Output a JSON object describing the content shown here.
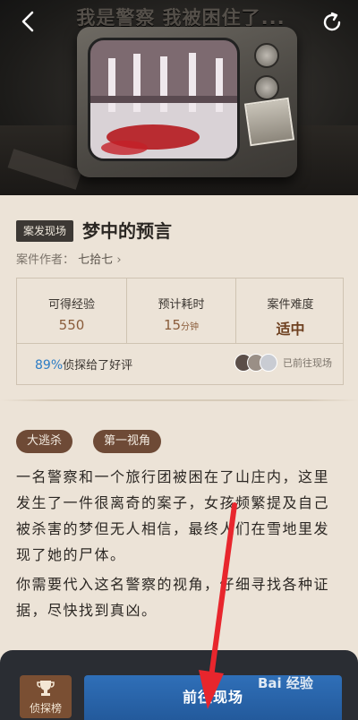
{
  "hero": {
    "banner_text": "我是警察 我被困住了..."
  },
  "case": {
    "tag": "案发现场",
    "title": "梦中的预言",
    "author_label": "案件作者：",
    "author_name": "七拾七"
  },
  "stats": {
    "items": [
      {
        "label": "可得经验",
        "value": "550",
        "unit": ""
      },
      {
        "label": "预计耗时",
        "value": "15",
        "unit": "分钟"
      },
      {
        "label": "案件难度",
        "value": "适中",
        "unit": ""
      }
    ],
    "rating_pct": "89%",
    "rating_text": "侦探给了好评",
    "visitors_text": "已前往现场"
  },
  "genres": [
    "大逃杀",
    "第一视角"
  ],
  "description": [
    "一名警察和一个旅行团被困在了山庄内，这里发生了一件很离奇的案子，女孩频繁提及自己被杀害的梦但无人相信，最终人们在雪地里发现了她的尸体。",
    "你需要代入这名警察的视角，仔细寻找各种证据，尽快找到真凶。"
  ],
  "bottom": {
    "rank_label": "侦探榜",
    "go_label": "前往现场"
  },
  "watermark": "Bai 经验",
  "colors": {
    "accent_blue": "#2f6fb8",
    "tag_brown": "#6e4a36",
    "annotation_red": "#e8262d"
  }
}
